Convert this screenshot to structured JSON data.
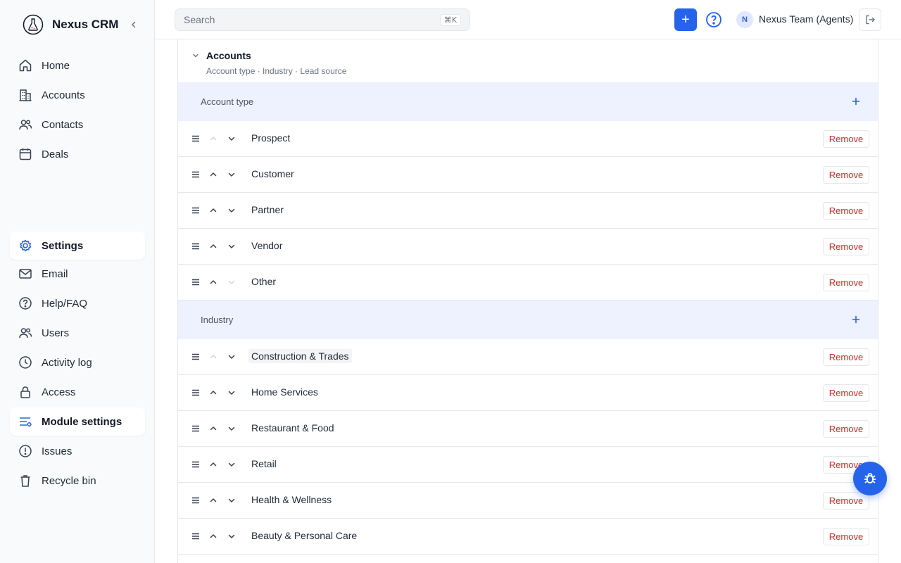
{
  "app": {
    "name": "Nexus CRM"
  },
  "sidebar": {
    "primary": [
      {
        "label": "Home",
        "icon": "home-icon"
      },
      {
        "label": "Accounts",
        "icon": "building-icon"
      },
      {
        "label": "Contacts",
        "icon": "users-icon"
      },
      {
        "label": "Deals",
        "icon": "calendar-icon"
      }
    ],
    "secondary": [
      {
        "label": "Settings",
        "icon": "settings-icon",
        "active": true
      },
      {
        "label": "Email",
        "icon": "mail-icon"
      },
      {
        "label": "Help/FAQ",
        "icon": "help-icon"
      },
      {
        "label": "Users",
        "icon": "users-icon"
      },
      {
        "label": "Activity log",
        "icon": "clock-icon"
      },
      {
        "label": "Access",
        "icon": "lock-icon"
      },
      {
        "label": "Module settings",
        "icon": "module-settings-icon",
        "active": true
      },
      {
        "label": "Issues",
        "icon": "alert-icon"
      },
      {
        "label": "Recycle bin",
        "icon": "trash-icon"
      }
    ]
  },
  "topbar": {
    "search_placeholder": "Search",
    "search_shortcut": "⌘K",
    "add_label": "+",
    "avatar_initial": "N",
    "user_name": "Nexus Team (Agents)"
  },
  "panel": {
    "title": "Accounts",
    "subtitle": "Account type · Industry · Lead source",
    "remove_label": "Remove",
    "groups": [
      {
        "name": "Account type",
        "items": [
          "Prospect",
          "Customer",
          "Partner",
          "Vendor",
          "Other"
        ]
      },
      {
        "name": "Industry",
        "items": [
          "Construction & Trades",
          "Home Services",
          "Restaurant & Food",
          "Retail",
          "Health & Wellness",
          "Beauty & Personal Care"
        ]
      }
    ]
  },
  "colors": {
    "accent": "#2563eb",
    "danger": "#dc2626",
    "group_bg": "#eef2ff"
  }
}
